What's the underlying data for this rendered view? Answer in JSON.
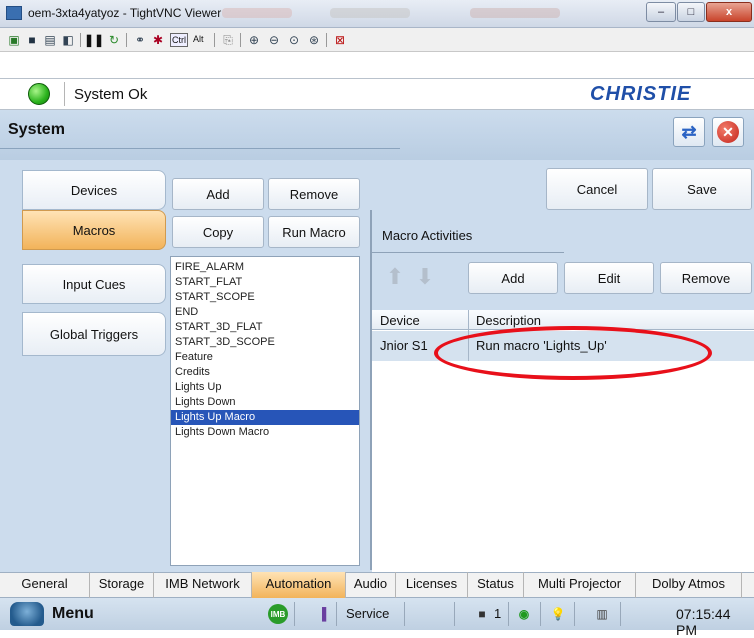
{
  "window": {
    "title": "oem-3xta4yatyoz - TightVNC Viewer",
    "min": "–",
    "max": "□",
    "close": "x"
  },
  "toolbar": {
    "ctrl": "Ctrl",
    "alt": "Alt"
  },
  "header": {
    "status": "System Ok",
    "logo": "CHRISTIE"
  },
  "system": {
    "title": "System"
  },
  "left_tabs": [
    "Devices",
    "Macros",
    "Input Cues",
    "Global Triggers"
  ],
  "macro_buttons": {
    "add": "Add",
    "remove": "Remove",
    "copy": "Copy",
    "run": "Run Macro"
  },
  "top_buttons": {
    "cancel": "Cancel",
    "save": "Save"
  },
  "macros": [
    "FIRE_ALARM",
    "START_FLAT",
    "START_SCOPE",
    "END",
    "START_3D_FLAT",
    "START_3D_SCOPE",
    "Feature",
    "Credits",
    "Lights Up",
    "Lights Down",
    "Lights Up Macro",
    "Lights Down Macro"
  ],
  "selected_macro": "Lights Up Macro",
  "activities": {
    "label": "Macro Activities",
    "add": "Add",
    "edit": "Edit",
    "remove": "Remove",
    "columns": [
      "Device",
      "Description"
    ],
    "rows": [
      {
        "device": "Jnior S1",
        "description": "Run macro 'Lights_Up'"
      }
    ]
  },
  "bottom_tabs": [
    "General",
    "Storage",
    "IMB Network",
    "Automation",
    "Audio",
    "Licenses",
    "Status",
    "Multi Projector",
    "Dolby Atmos"
  ],
  "active_bottom_tab": "Automation",
  "statusbar": {
    "menu": "Menu",
    "imb": "IMB",
    "service": "Service",
    "cam_count": "1",
    "clock": "07:15:44 PM"
  }
}
